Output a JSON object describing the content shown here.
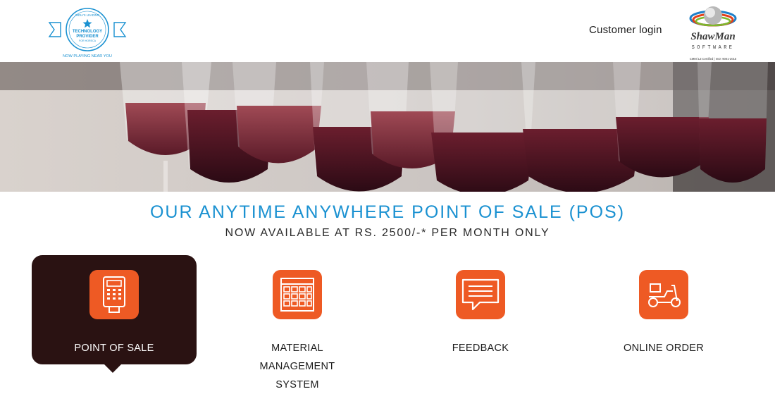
{
  "header": {
    "badge": {
      "top_text": "INDIA'S LEADING",
      "line1": "TECHNOLOGY",
      "line2": "PROVIDER",
      "line3": "FOR HORECA",
      "tagline": "NOW PLAYING NEAR YOU"
    },
    "customer_login": "Customer login",
    "brand": {
      "name": "ShawMan",
      "sub": "SOFTWARE",
      "cert": "CMMi L3 Certified | ISO: 9001-2015"
    }
  },
  "headline": {
    "title": "OUR ANYTIME ANYWHERE POINT OF SALE (POS)",
    "subtitle": "NOW AVAILABLE AT RS. 2500/-* PER MONTH ONLY"
  },
  "features": [
    {
      "label": "POINT OF SALE",
      "icon": "pos-terminal-icon",
      "active": true
    },
    {
      "label": "MATERIAL MANAGEMENT SYSTEM",
      "icon": "inventory-grid-icon",
      "active": false
    },
    {
      "label": "FEEDBACK",
      "icon": "feedback-bubble-icon",
      "active": false
    },
    {
      "label": "ONLINE ORDER",
      "icon": "delivery-scooter-icon",
      "active": false
    }
  ],
  "colors": {
    "accent_blue": "#1a91d1",
    "icon_orange": "#ee5a24",
    "active_tile": "#2a1212"
  }
}
